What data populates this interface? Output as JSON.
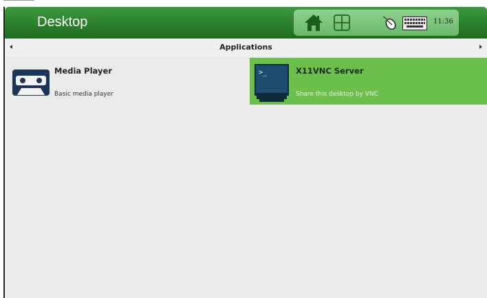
{
  "window": {
    "title": "Desktop"
  },
  "tray": {
    "clock": "11:36",
    "icons": [
      "home-icon",
      "windows-icon",
      "mouse-icon",
      "keyboard-icon"
    ]
  },
  "section": {
    "title": "Applications"
  },
  "apps": [
    {
      "name": "Media Player",
      "description": "Basic media player",
      "icon": "cassette-icon",
      "selected": false
    },
    {
      "name": "X11VNC Server",
      "description": "Share this desktop by VNC",
      "icon": "terminal-monitor-icon",
      "selected": true
    }
  ],
  "colors": {
    "titlebar": "#2e822e",
    "selected": "#6cbf4c",
    "background": "#e8ebe8"
  }
}
